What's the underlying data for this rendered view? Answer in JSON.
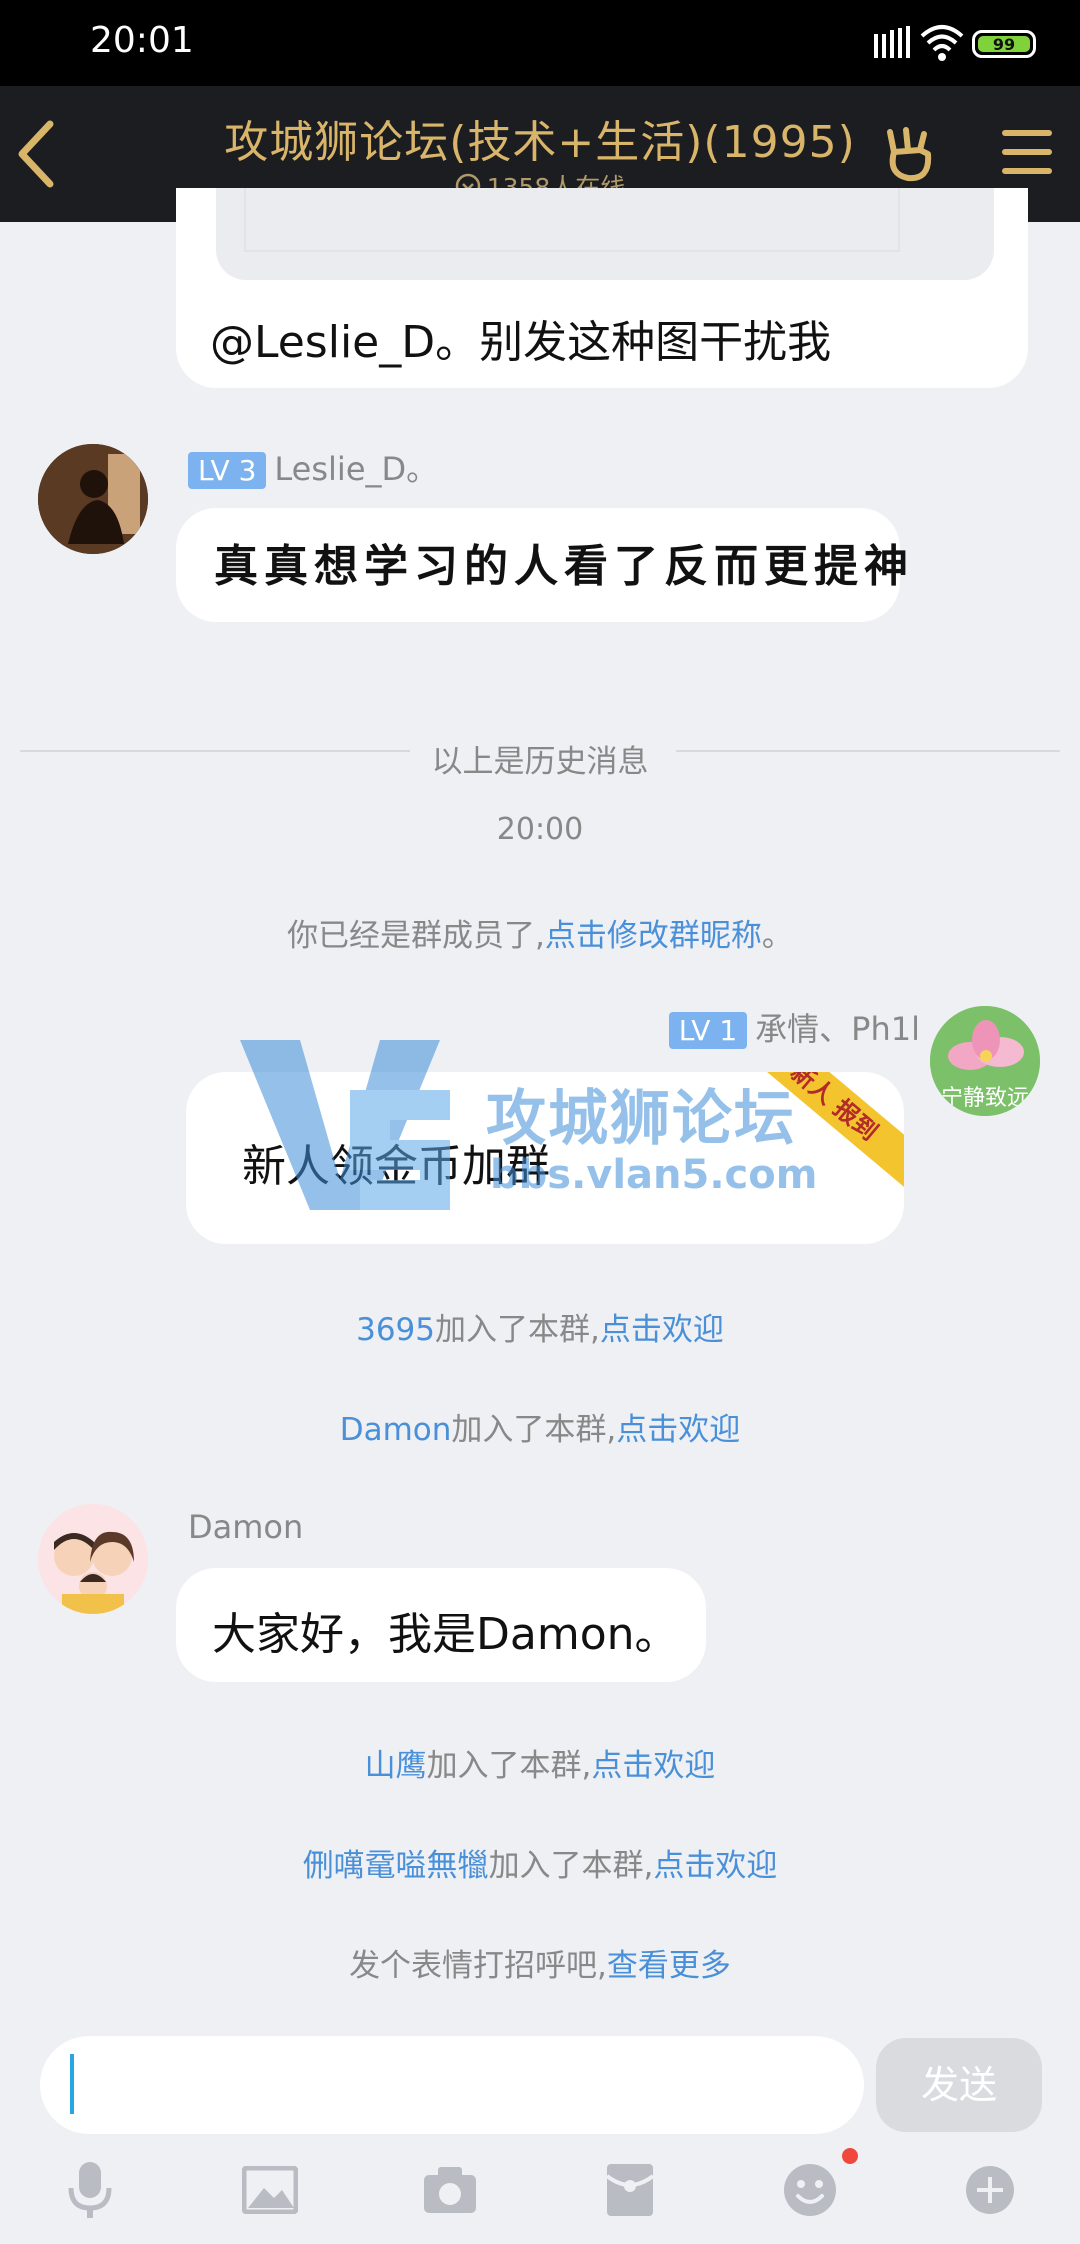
{
  "status_bar": {
    "time": "20:01",
    "battery": "99"
  },
  "header": {
    "title": "攻城狮论坛(技术+生活)(1995)",
    "online": "1358人在线"
  },
  "messages": {
    "quoted_reply_text": "@Leslie_D。别发这种图干扰我",
    "leslie": {
      "level": "LV 3",
      "name": "Leslie_D。",
      "text": "真真想学习的人看了反而更提神"
    },
    "history_label": "以上是历史消息",
    "timestamp": "20:00",
    "member_notice": {
      "prefix": "你已经是群成员了,",
      "link": "点击修改群昵称",
      "suffix": "。"
    },
    "phil": {
      "level": "LV 1",
      "name": "承情、Ph1l",
      "text": "新人领金币加群",
      "badge": "新人 报到",
      "avatar_caption": "宁静致远"
    },
    "joins": [
      {
        "user": "3695",
        "text": "加入了本群,",
        "link": "点击欢迎"
      },
      {
        "user": "Damon",
        "text": "加入了本群,",
        "link": "点击欢迎"
      }
    ],
    "damon": {
      "name": "Damon",
      "text": "大家好，我是Damon。"
    },
    "joins2": [
      {
        "user": "山鹰",
        "text": "加入了本群,",
        "link": "点击欢迎"
      },
      {
        "user": "侀噧鼋嗌無犣",
        "text": "加入了本群,",
        "link": "点击欢迎"
      }
    ],
    "emoji_hint": {
      "text": "发个表情打招呼吧,",
      "link": "查看更多"
    }
  },
  "watermark": {
    "title": "攻城狮论坛",
    "url": "bbs.vlan5.com"
  },
  "composer": {
    "value": "",
    "send_label": "发送"
  },
  "toolbar": [
    "mic-icon",
    "image-icon",
    "camera-icon",
    "redpacket-icon",
    "emoji-icon",
    "plus-icon"
  ],
  "colors": {
    "accent_gold": "#d9b56a",
    "link_blue": "#4a90d9",
    "header_bg": "#1c1d21"
  }
}
